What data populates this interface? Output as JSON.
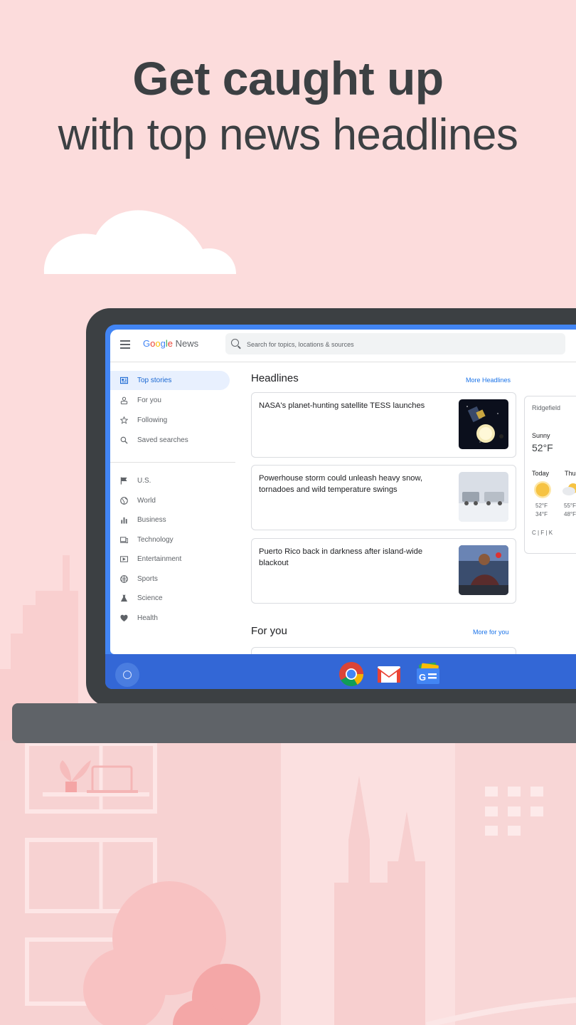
{
  "hero": {
    "line1": "Get caught up",
    "line2": "with top news headlines"
  },
  "app": {
    "logo": {
      "google": "Google",
      "product": "News"
    },
    "search": {
      "placeholder": "Search for topics, locations & sources"
    },
    "sidebar": {
      "primary": [
        {
          "label": "Top stories",
          "icon": "newspaper-icon",
          "active": true
        },
        {
          "label": "For you",
          "icon": "person-icon"
        },
        {
          "label": "Following",
          "icon": "star-icon"
        },
        {
          "label": "Saved searches",
          "icon": "search-icon"
        }
      ],
      "topics": [
        {
          "label": "U.S.",
          "icon": "flag-icon"
        },
        {
          "label": "World",
          "icon": "globe-icon"
        },
        {
          "label": "Business",
          "icon": "bar-chart-icon"
        },
        {
          "label": "Technology",
          "icon": "devices-icon"
        },
        {
          "label": "Entertainment",
          "icon": "film-icon"
        },
        {
          "label": "Sports",
          "icon": "ball-icon"
        },
        {
          "label": "Science",
          "icon": "flask-icon"
        },
        {
          "label": "Health",
          "icon": "heart-icon"
        }
      ]
    },
    "headlines": {
      "title": "Headlines",
      "more": "More Headlines",
      "cards": [
        {
          "title": "NASA's planet-hunting satellite TESS launches"
        },
        {
          "title": "Powerhouse storm could unleash heavy snow, tornadoes and wild temperature swings"
        },
        {
          "title": "Puerto Rico back in darkness after island-wide blackout"
        }
      ]
    },
    "for_you": {
      "title": "For you",
      "more": "More for you"
    },
    "weather": {
      "location": "Ridgefield",
      "condition": "Sunny",
      "temp": "52°F",
      "today_label": "Today",
      "next_label": "Thu",
      "today_high": "52°F",
      "today_low": "34°F",
      "next_high": "55°F",
      "next_low": "48°F",
      "units": "C | F | K"
    }
  },
  "colors": {
    "background": "#fcdcdc",
    "accent": "#1a73e8",
    "shelf": "#3367d6"
  }
}
